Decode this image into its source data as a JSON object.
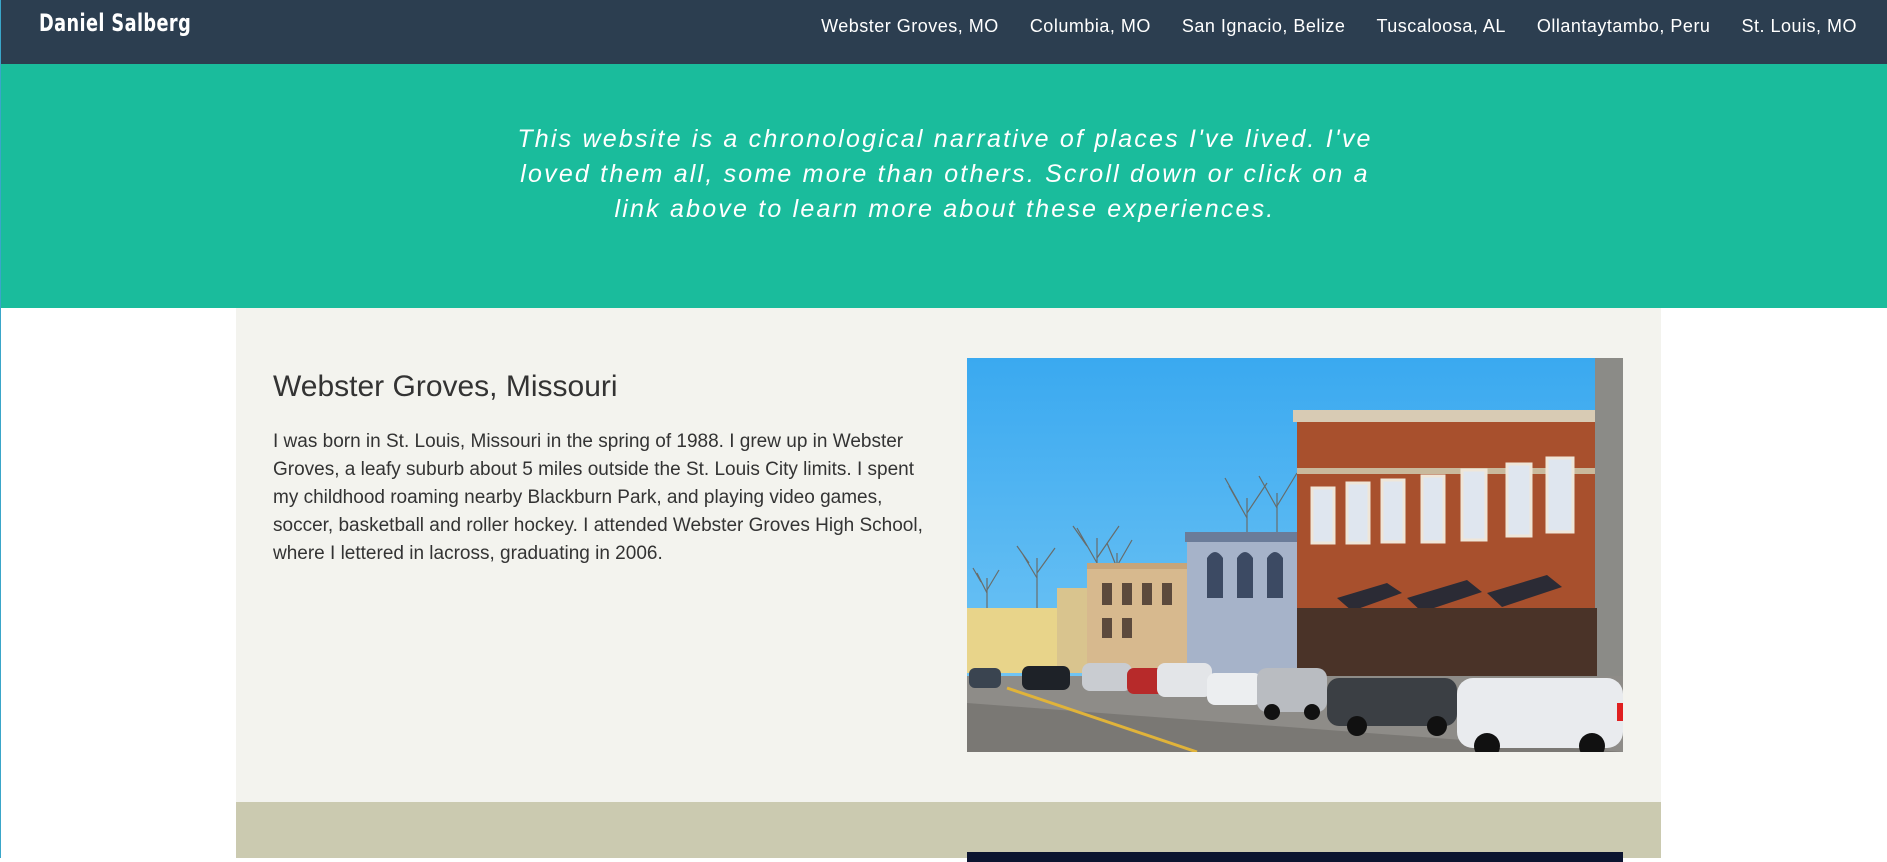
{
  "brand": "Daniel Salberg",
  "nav": [
    "Webster Groves, MO",
    "Columbia, MO",
    "San Ignacio, Belize",
    "Tuscaloosa, AL",
    "Ollantaytambo, Peru",
    "St. Louis, MO"
  ],
  "hero": {
    "text": "This website is a chronological narrative of places I've lived. I've loved them all, some more than others. Scroll down or click on a link above to learn more about these experiences."
  },
  "sections": [
    {
      "title": "Webster Groves, Missouri",
      "body": "I was born in St. Louis, Missouri in the spring of 1988. I grew up in Webster Groves, a leafy suburb about 5 miles outside the St. Louis City limits. I spent my childhood roaming nearby Blackburn Park, and playing video games, soccer, basketball and roller hockey. I attended Webster Groves High School, where I lettered in lacross, graduating in 2006."
    }
  ],
  "colors": {
    "navbar": "#2c3e50",
    "hero": "#1abc9c",
    "section_light": "#f3f3ee",
    "section_tan": "#cbcab0"
  }
}
